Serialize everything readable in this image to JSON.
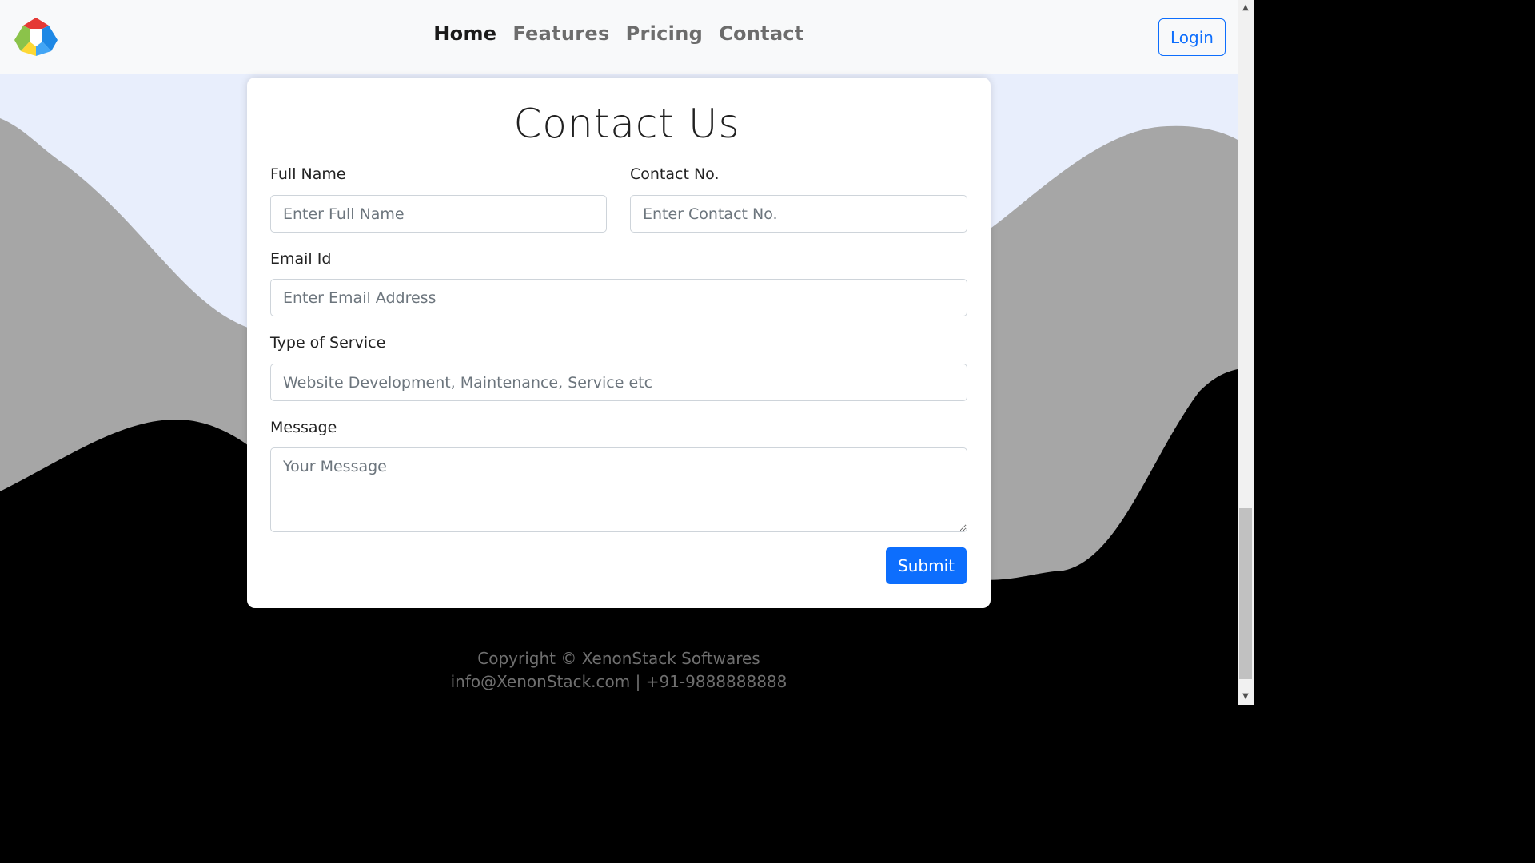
{
  "nav": {
    "logo_name": "logo-icon",
    "links": [
      {
        "label": "Home",
        "active": true
      },
      {
        "label": "Features",
        "active": false
      },
      {
        "label": "Pricing",
        "active": false
      },
      {
        "label": "Contact",
        "active": false
      }
    ],
    "login_label": "Login"
  },
  "form": {
    "title": "Contact Us",
    "full_name": {
      "label": "Full Name",
      "placeholder": "Enter Full Name",
      "value": ""
    },
    "contact_no": {
      "label": "Contact No.",
      "placeholder": "Enter Contact No.",
      "value": ""
    },
    "email": {
      "label": "Email Id",
      "placeholder": "Enter Email Address",
      "value": ""
    },
    "service": {
      "label": "Type of Service",
      "placeholder": "Website Development, Maintenance, Service etc",
      "value": ""
    },
    "message": {
      "label": "Message",
      "placeholder": "Your Message",
      "value": ""
    },
    "submit_label": "Submit"
  },
  "footer": {
    "copyright": "Copyright © XenonStack Softwares",
    "contact": "info@XenonStack.com | +91-9888888888"
  },
  "colors": {
    "accent": "#0d6efd",
    "top_background": "#e8eefc",
    "wave_gray": "#a6a6a6",
    "footer_background": "#000000"
  }
}
